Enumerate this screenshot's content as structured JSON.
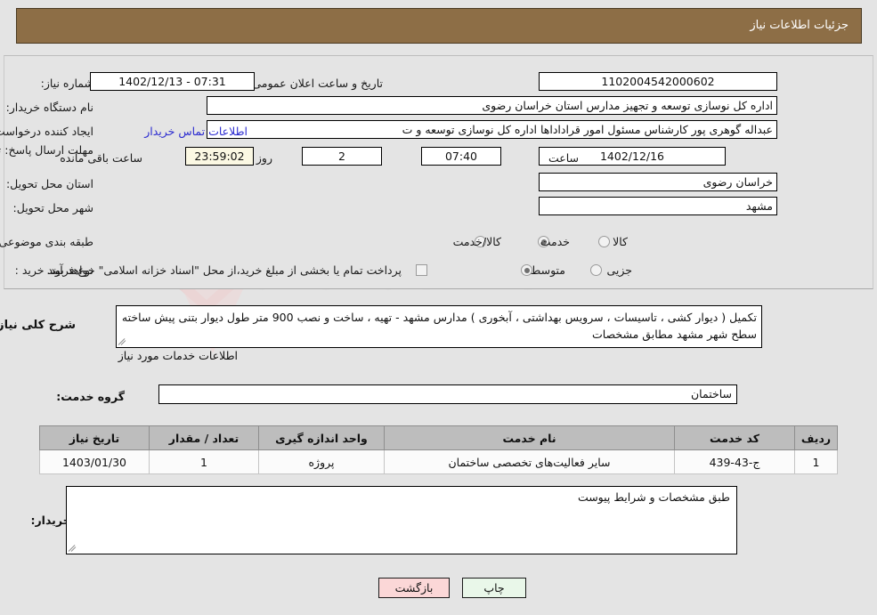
{
  "header": {
    "title": "جزئیات اطلاعات نیاز"
  },
  "watermark": {
    "text": "AriaTender.net"
  },
  "top": {
    "need_number_label": "شماره نیاز:",
    "need_number_value": "1102004542000602",
    "announce_label": "تاریخ و ساعت اعلان عمومی:",
    "announce_value": "07:31 - 1402/12/13",
    "buyer_org_label": "نام دستگاه خریدار:",
    "buyer_org_value": "اداره کل نوسازی  توسعه و تجهیز مدارس استان خراسان رضوی",
    "creator_label": "ایجاد کننده درخواست:",
    "creator_value": "عبداله گوهری پور کارشناس مسئول امور قراداداها  اداره کل نوسازی  توسعه و ت",
    "contact_link": "اطلاعات تماس خریدار",
    "deadline_label": "مهلت ارسال پاسخ: تا تاریخ:",
    "deadline_date": "1402/12/16",
    "hour_label": "ساعت",
    "deadline_time": "07:40",
    "days_value": "2",
    "days_label": "روز و",
    "countdown_value": "23:59:02",
    "countdown_label": "ساعت باقی مانده",
    "province_label": "استان محل تحویل:",
    "province_value": "خراسان رضوی",
    "city_label": "شهر محل تحویل:",
    "city_value": "مشهد",
    "category_label": "طبقه بندی موضوعی:",
    "category_options": [
      {
        "label": "کالا",
        "selected": false
      },
      {
        "label": "خدمت",
        "selected": true
      },
      {
        "label": "کالا/خدمت",
        "selected": false
      }
    ],
    "process_label": "نوع فرآیند خرید :",
    "process_options": [
      {
        "label": "جزیی",
        "selected": false
      },
      {
        "label": "متوسط",
        "selected": true
      }
    ],
    "treasury_checkbox_label": "پرداخت تمام یا بخشی از مبلغ خرید،از محل \"اسناد خزانه اسلامی\" خواهد بود.",
    "treasury_checked": false
  },
  "description": {
    "label": "شرح کلی نیاز:",
    "value": "تکمیل ( دیوار کشی ، تاسیسات ، سرویس بهداشتی ، آبخوری ) مدارس مشهد - تهیه ، ساخت و نصب 900 متر طول دیوار بتنی پیش ساخته سطح شهر مشهد مطابق مشخصات"
  },
  "services": {
    "section_title": "اطلاعات خدمات مورد نیاز",
    "group_label": "گروه خدمت:",
    "group_value": "ساختمان",
    "table": {
      "columns": [
        "ردیف",
        "کد خدمت",
        "نام خدمت",
        "واحد اندازه گیری",
        "تعداد / مقدار",
        "تاریخ نیاز"
      ],
      "rows": [
        [
          "1",
          "ج-43-439",
          "سایر فعالیت‌های تخصصی ساختمان",
          "پروژه",
          "1",
          "1403/01/30"
        ]
      ]
    }
  },
  "notes": {
    "label": "توضیحات خریدار:",
    "value": "طبق مشخصات و شرایط پیوست"
  },
  "footer": {
    "print_label": "چاپ",
    "back_label": "بازگشت"
  }
}
